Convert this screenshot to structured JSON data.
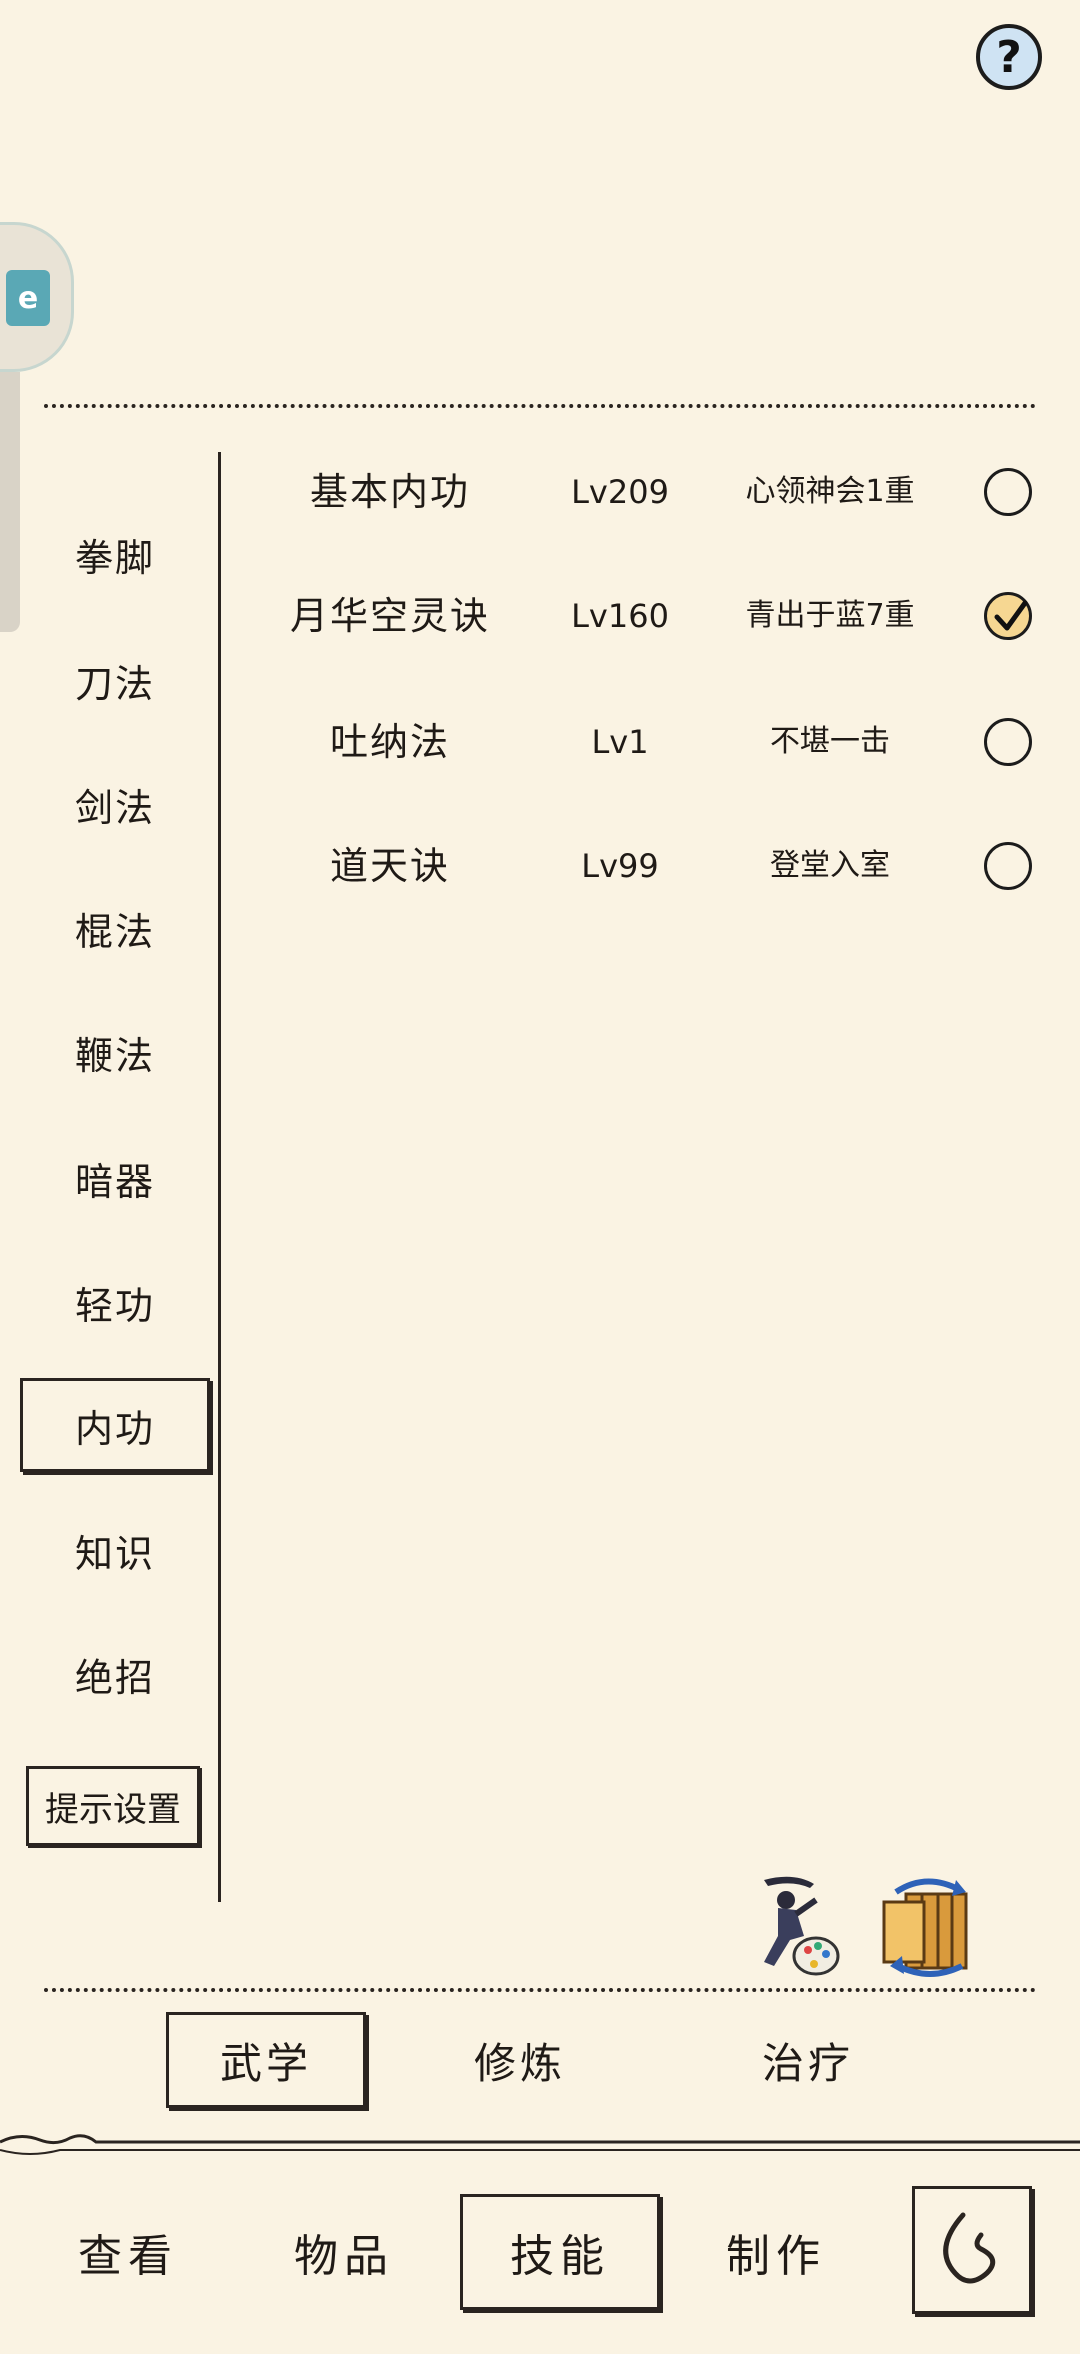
{
  "help": {
    "label": "?"
  },
  "floating_badge": {
    "icon": "assistant-icon"
  },
  "categories": [
    {
      "label": "拳脚",
      "active": false
    },
    {
      "label": "刀法",
      "active": false
    },
    {
      "label": "剑法",
      "active": false
    },
    {
      "label": "棍法",
      "active": false
    },
    {
      "label": "鞭法",
      "active": false
    },
    {
      "label": "暗器",
      "active": false
    },
    {
      "label": "轻功",
      "active": false
    },
    {
      "label": "内功",
      "active": true
    },
    {
      "label": "知识",
      "active": false
    },
    {
      "label": "绝招",
      "active": false
    }
  ],
  "hint_settings": {
    "label": "提示设置"
  },
  "skills": [
    {
      "name": "基本内功",
      "level": "Lv209",
      "rank": "心领神会1重",
      "checked": false
    },
    {
      "name": "月华空灵诀",
      "level": "Lv160",
      "rank": "青出于蓝7重",
      "checked": true
    },
    {
      "name": "吐纳法",
      "level": "Lv1",
      "rank": "不堪一击",
      "checked": false
    },
    {
      "name": "道天诀",
      "level": "Lv99",
      "rank": "登堂入室",
      "checked": false
    }
  ],
  "art_icons": {
    "left": "warrior-palette-icon",
    "right": "scroll-swap-icon"
  },
  "subtabs": [
    {
      "label": "武学",
      "active": true
    },
    {
      "label": "修炼",
      "active": false
    },
    {
      "label": "治疗",
      "active": false
    }
  ],
  "nav": [
    {
      "label": "查看",
      "active": false
    },
    {
      "label": "物品",
      "active": false
    },
    {
      "label": "技能",
      "active": true
    },
    {
      "label": "制作",
      "active": false
    }
  ],
  "back_button": {
    "icon": "back-arrow-icon"
  }
}
